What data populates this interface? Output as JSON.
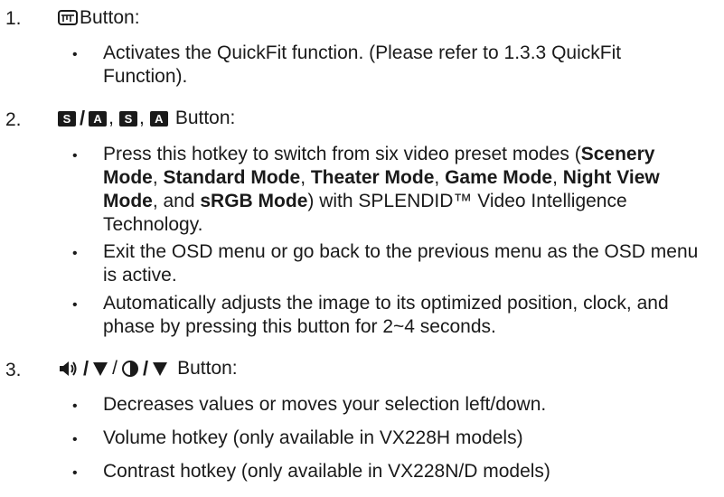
{
  "items": [
    {
      "number": "1.",
      "label": "Button:",
      "icons": [
        "quickfit-key-icon"
      ],
      "bullets": [
        {
          "parts": [
            {
              "text": "Activates the QuickFit function. (Please refer to 1.3.3 QuickFit Function).",
              "bold": false
            }
          ]
        }
      ]
    },
    {
      "number": "2.",
      "label": "Button:",
      "icons": [
        "s-key-icon",
        "a-key-icon",
        "s-key-icon",
        "a-key-icon"
      ],
      "key_letters": {
        "s": "S",
        "a": "A"
      },
      "separators": {
        "slash": "/",
        "comma": ","
      },
      "bullets": [
        {
          "parts": [
            {
              "text": "Press this hotkey to switch from six video preset modes (",
              "bold": false
            },
            {
              "text": "Scenery Mode",
              "bold": true
            },
            {
              "text": ", ",
              "bold": false
            },
            {
              "text": "Standard Mode",
              "bold": true
            },
            {
              "text": ", ",
              "bold": false
            },
            {
              "text": "Theater Mode",
              "bold": true
            },
            {
              "text": ", ",
              "bold": false
            },
            {
              "text": "Game Mode",
              "bold": true
            },
            {
              "text": ", ",
              "bold": false
            },
            {
              "text": "Night View Mode",
              "bold": true
            },
            {
              "text": ", and ",
              "bold": false
            },
            {
              "text": "sRGB Mode",
              "bold": true
            },
            {
              "text": ") with SPLENDID™ Video Intelligence Technology.",
              "bold": false
            }
          ]
        },
        {
          "parts": [
            {
              "text": "Exit the OSD menu or go back to the previous menu as the OSD menu is active.",
              "bold": false
            }
          ]
        },
        {
          "parts": [
            {
              "text": "Automatically adjusts the image to its optimized position, clock, and phase by pressing this button for 2~4 seconds.",
              "bold": false
            }
          ]
        }
      ]
    },
    {
      "number": "3.",
      "label": "Button:",
      "icons": [
        "volume-icon",
        "down-triangle-icon",
        "contrast-icon",
        "down-triangle-icon"
      ],
      "bullets": [
        {
          "parts": [
            {
              "text": "Decreases values or moves your selection left/down.",
              "bold": false
            }
          ]
        },
        {
          "parts": [
            {
              "text": "Volume hotkey (only available in VX228H models)",
              "bold": false
            }
          ]
        },
        {
          "parts": [
            {
              "text": "Contrast hotkey (only available in VX228N/D models)",
              "bold": false
            }
          ]
        }
      ]
    }
  ],
  "bullet_char": "•"
}
